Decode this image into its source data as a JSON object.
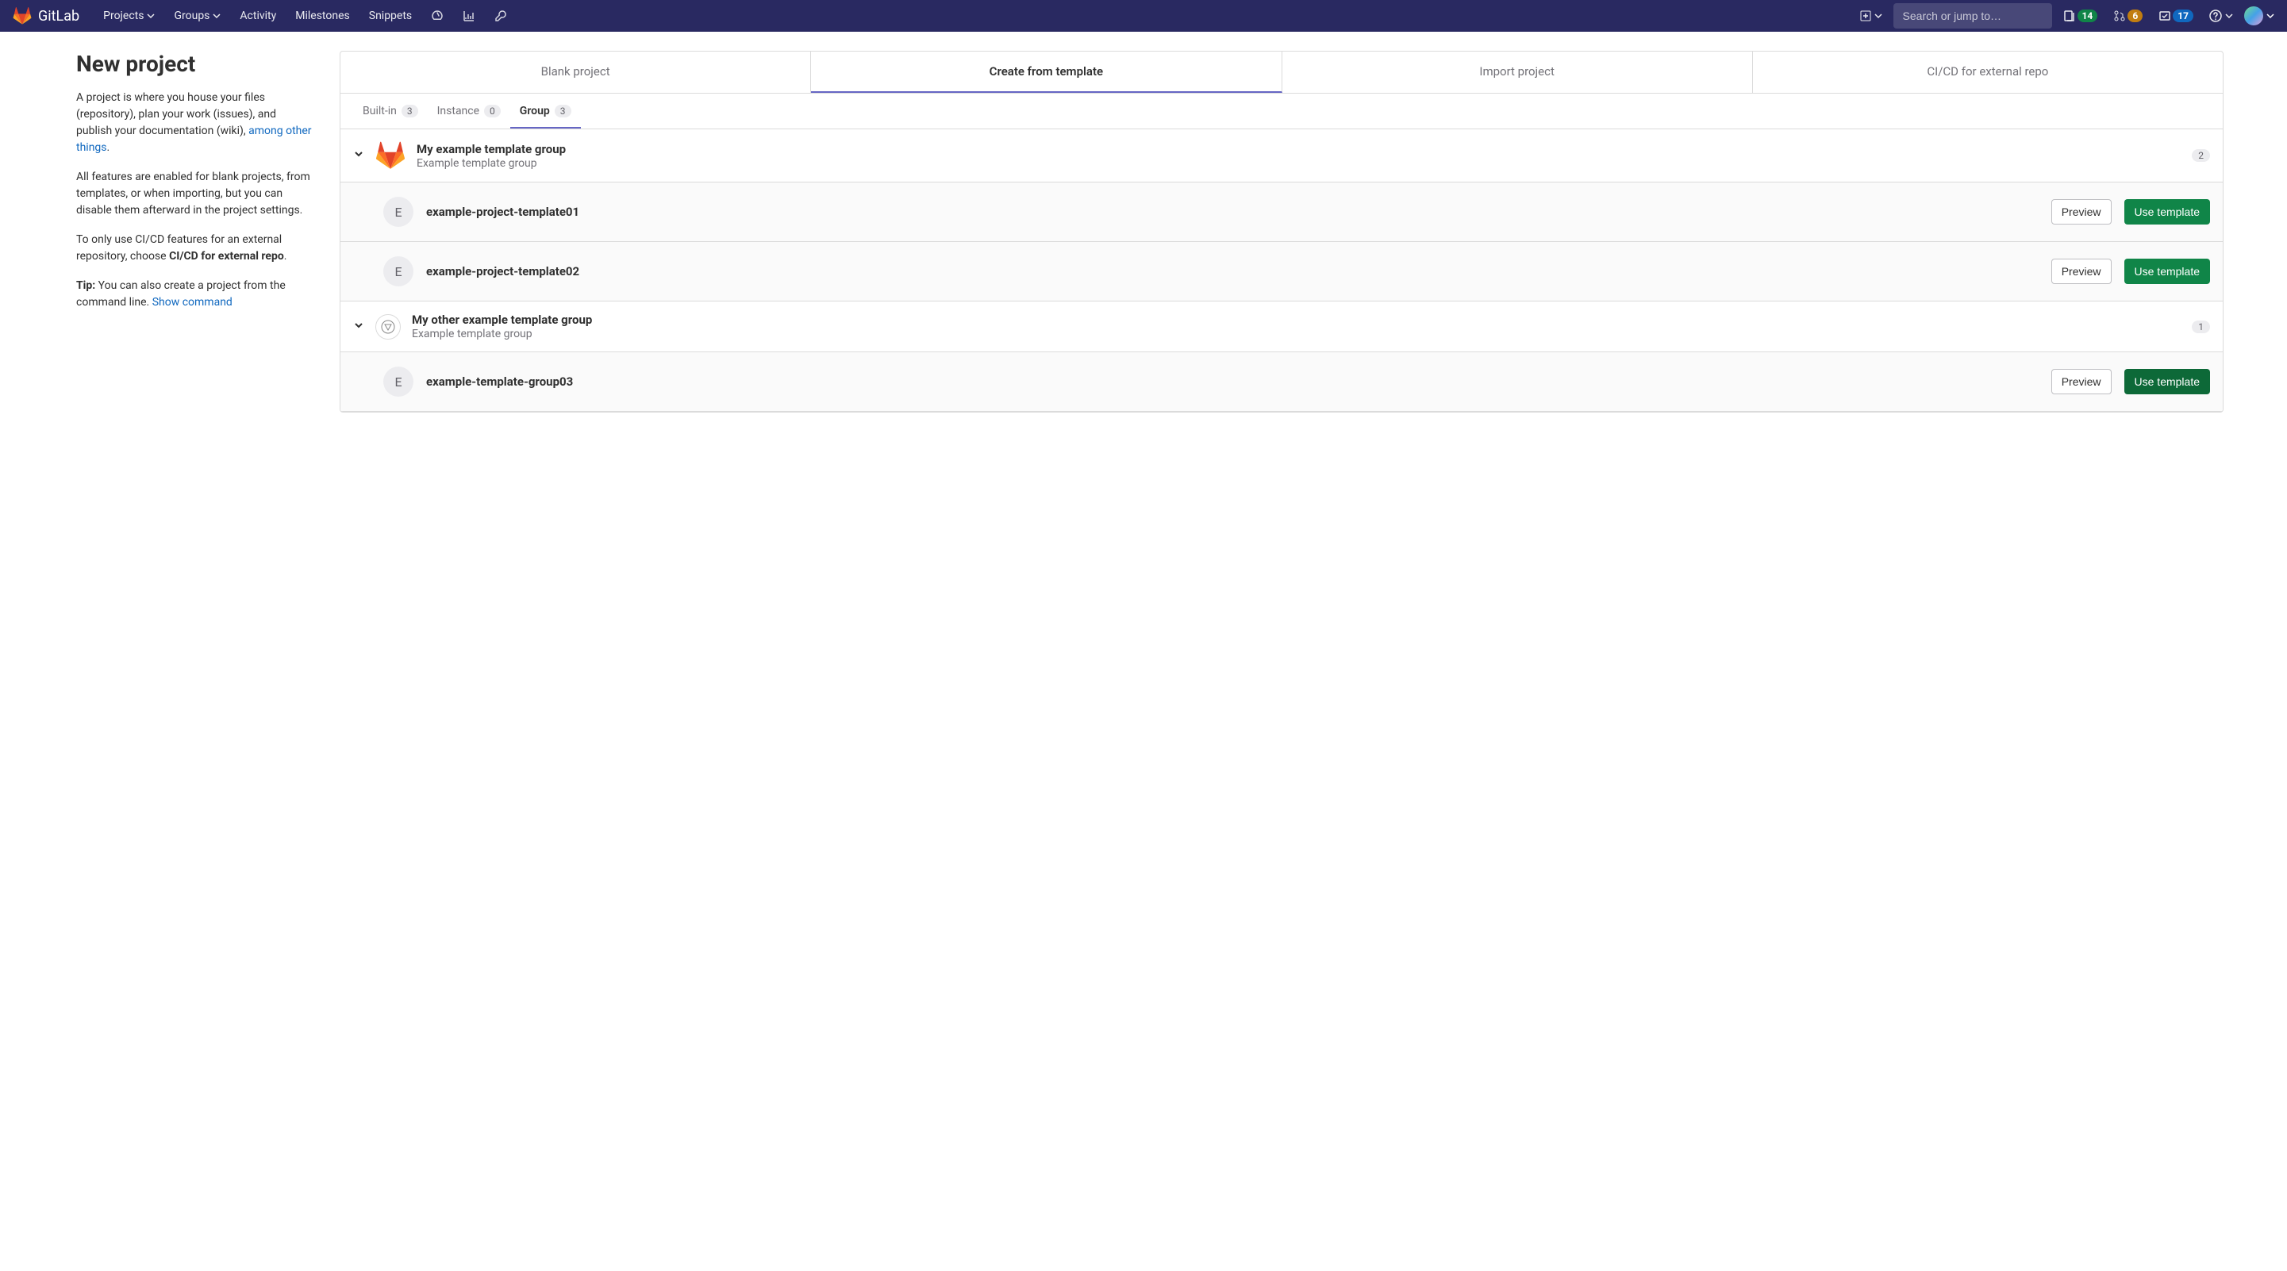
{
  "navbar": {
    "brand": "GitLab",
    "items": [
      "Projects",
      "Groups",
      "Activity",
      "Milestones",
      "Snippets"
    ],
    "search_placeholder": "Search or jump to…",
    "badges": {
      "issues": "14",
      "mrs": "6",
      "todos": "17"
    }
  },
  "sidebar": {
    "title": "New project",
    "p1a": "A project is where you house your files (repository), plan your work (issues), and publish your documentation (wiki), ",
    "p1_link": "among other things",
    "p1b": ".",
    "p2": "All features are enabled for blank projects, from templates, or when importing, but you can disable them afterward in the project settings.",
    "p3a": "To only use CI/CD features for an external repository, choose ",
    "p3b": "CI/CD for external repo",
    "p3c": ".",
    "p4a": "Tip:",
    "p4b": " You can also create a project from the command line. ",
    "p4_link": "Show command"
  },
  "main_tabs": [
    "Blank project",
    "Create from template",
    "Import project",
    "CI/CD for external repo"
  ],
  "sub_tabs": [
    {
      "label": "Built-in",
      "count": "3"
    },
    {
      "label": "Instance",
      "count": "0"
    },
    {
      "label": "Group",
      "count": "3"
    }
  ],
  "groups": [
    {
      "name": "My example template group",
      "desc": "Example template group",
      "count": "2",
      "icon": "gitlab",
      "templates": [
        {
          "letter": "E",
          "name": "example-project-template01"
        },
        {
          "letter": "E",
          "name": "example-project-template02"
        }
      ]
    },
    {
      "name": "My other example template group",
      "desc": "Example template group",
      "count": "1",
      "icon": "circle",
      "templates": [
        {
          "letter": "E",
          "name": "example-template-group03"
        }
      ]
    }
  ],
  "buttons": {
    "preview": "Preview",
    "use": "Use template"
  }
}
